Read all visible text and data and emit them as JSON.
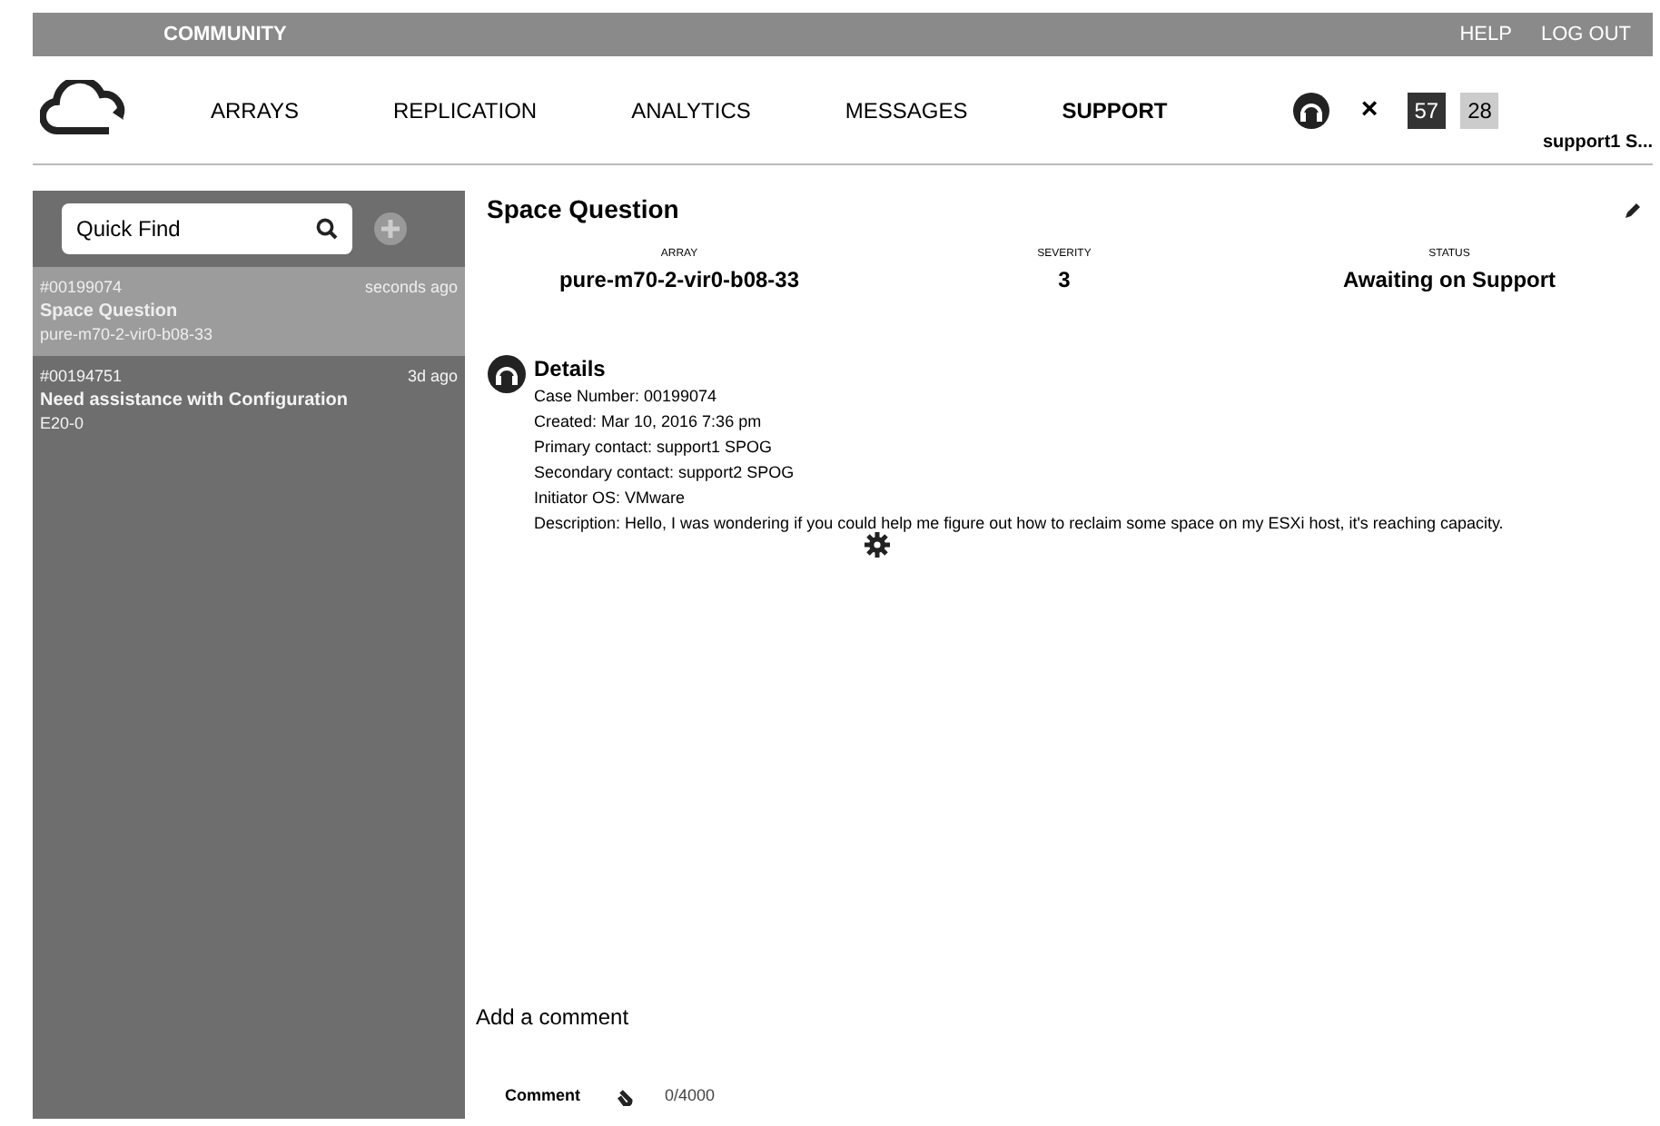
{
  "top_bar": {
    "links": [
      {
        "label": "COMMUNITY",
        "selected": true
      }
    ],
    "right_links": [
      "HELP",
      "LOG OUT"
    ]
  },
  "nav": {
    "items": [
      {
        "label": "ARRAYS",
        "selected": false
      },
      {
        "label": "REPLICATION",
        "selected": false
      },
      {
        "label": "ANALYTICS",
        "selected": false
      },
      {
        "label": "MESSAGES",
        "selected": false
      },
      {
        "label": "SUPPORT",
        "selected": true
      }
    ],
    "close": "×",
    "badges": [
      {
        "text": "57",
        "kind": "dark"
      },
      {
        "text": "28",
        "kind": "light"
      }
    ],
    "user": "support1 S..."
  },
  "sidebar": {
    "search": {
      "placeholder": "Quick Find"
    },
    "cases": [
      {
        "number": "#00199074",
        "time": "seconds ago",
        "title": "Space Question",
        "array": "pure-m70-2-vir0-b08-33",
        "selected": true
      },
      {
        "number": "#00194751",
        "time": "3d ago",
        "title": "Need assistance with Configuration",
        "array": "E20-0",
        "selected": false
      }
    ]
  },
  "case": {
    "title": "Space Question",
    "fields": [
      {
        "label": "ARRAY",
        "value": "pure-m70-2-vir0-b08-33"
      },
      {
        "label": "SEVERITY",
        "value": "3"
      },
      {
        "label": "STATUS",
        "value": "Awaiting on Support"
      }
    ],
    "details": {
      "heading": "Details",
      "lines": [
        "Case Number: 00199074",
        "Created: Mar 10, 2016 7:36 pm",
        "Primary contact: support1 SPOG",
        "Secondary contact: support2 SPOG",
        "Initiator OS: VMware",
        "Description: Hello, I was wondering if you could help me figure out how to reclaim some space on my ESXi host, it's reaching capacity."
      ]
    }
  },
  "comment": {
    "prompt": "Add a comment",
    "label": "Comment",
    "count": "0/4000"
  }
}
